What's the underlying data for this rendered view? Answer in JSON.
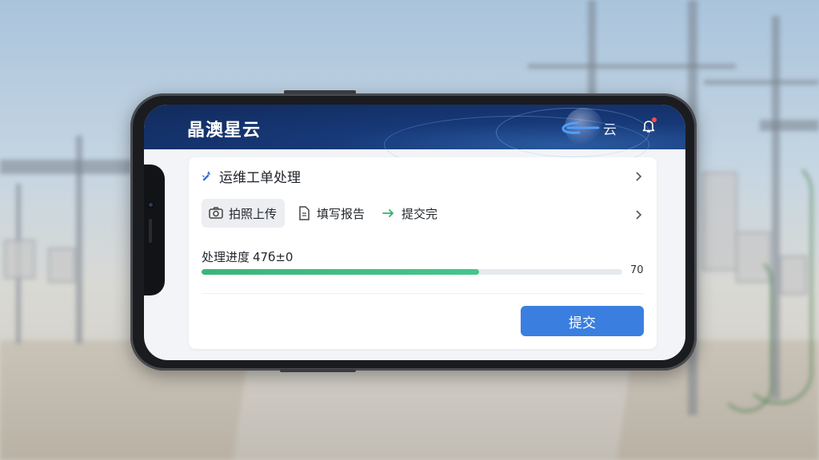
{
  "app": {
    "brand": "晶澳星云",
    "logo_mark": "C",
    "logo_text": "云"
  },
  "card": {
    "title": "运维工单处理",
    "steps": [
      {
        "label": "拍照上传",
        "icon": "camera-icon",
        "active": true
      },
      {
        "label": "填写报告",
        "icon": "document-icon",
        "active": false
      },
      {
        "label": "提交完",
        "icon": "arrow-right-icon",
        "active": false
      }
    ],
    "progress": {
      "label": "处理进度",
      "percent_text": "47б±0",
      "fraction": 0.66,
      "end_value": "70"
    },
    "submit_label": "提交"
  },
  "colors": {
    "header": "#173978",
    "accent": "#3a7fe0",
    "progress": "#46c58a"
  }
}
